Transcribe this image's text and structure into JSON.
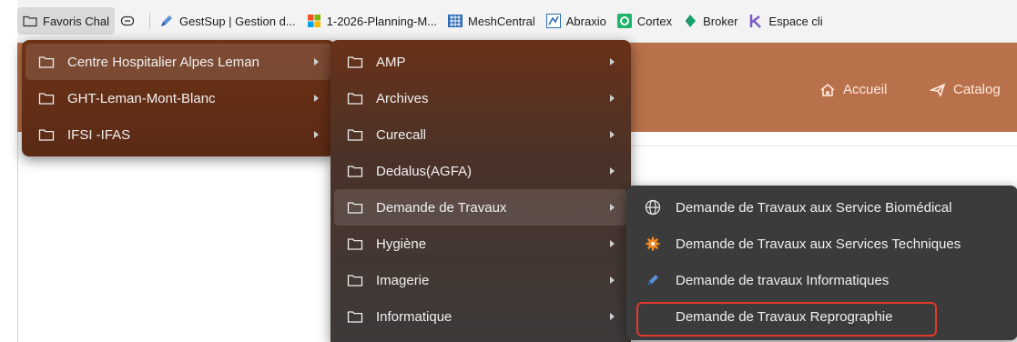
{
  "bookmarks": [
    {
      "label": "Favoris Chal",
      "icon": "bookmark-folder-icon",
      "active": true
    },
    {
      "label": "",
      "icon": "reading-list-icon"
    },
    {
      "label": "GestSup | Gestion d...",
      "icon": "gestsup-pencil-icon"
    },
    {
      "label": "1-2026-Planning-M...",
      "icon": "microsoft-logo-icon"
    },
    {
      "label": "MeshCentral",
      "icon": "meshcentral-icon"
    },
    {
      "label": "Abraxio",
      "icon": "abraxio-icon"
    },
    {
      "label": "Cortex",
      "icon": "cortex-icon"
    },
    {
      "label": "Broker",
      "icon": "broker-icon"
    },
    {
      "label": "Espace cli",
      "icon": "espace-client-k-icon"
    }
  ],
  "site_nav": {
    "home": "Accueil",
    "catalog": "Catalog"
  },
  "menu1": [
    {
      "label": "Centre Hospitalier Alpes Leman",
      "highlighted": true
    },
    {
      "label": "GHT-Leman-Mont-Blanc"
    },
    {
      "label": "IFSI -IFAS"
    }
  ],
  "menu2": [
    {
      "label": "AMP"
    },
    {
      "label": "Archives"
    },
    {
      "label": "Curecall"
    },
    {
      "label": "Dedalus(AGFA)"
    },
    {
      "label": "Demande de Travaux",
      "highlighted": true
    },
    {
      "label": "Hygiène"
    },
    {
      "label": "Imagerie"
    },
    {
      "label": "Informatique"
    }
  ],
  "menu3": [
    {
      "label": "Demande de Travaux aux Service Biomédical",
      "icon": "globe-icon"
    },
    {
      "label": "Demande de Travaux aux Services Techniques",
      "icon": "orange-gear-icon"
    },
    {
      "label": "Demande de travaux Informatiques",
      "icon": "gestsup-pencil-icon"
    },
    {
      "label": "Demande de Travaux Reprographie",
      "icon": "none",
      "focused": true
    }
  ],
  "colors": {
    "header": "#b9714b",
    "focus_outline": "#e0382a",
    "menu_bg": "#3b3b3b"
  }
}
